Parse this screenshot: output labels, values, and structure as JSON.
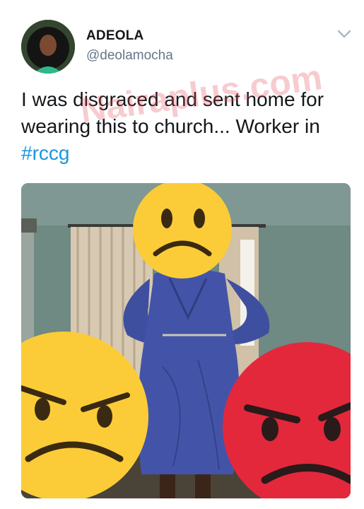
{
  "author": {
    "display_name": "ADEOLA",
    "handle": "@deolamocha"
  },
  "tweet": {
    "text_line1": "I was disgraced and sent home for",
    "text_line2": "wearing this to church... Worker in",
    "hashtag": "#rccg"
  },
  "watermark": {
    "text": "Nairaplus.com"
  },
  "icons": {
    "menu": "chevron-down-icon"
  },
  "colors": {
    "hashtag": "#1b95e0",
    "handle": "#657786",
    "sad_emoji": "#fbcc38",
    "angry_emoji_red": "#e3283c"
  }
}
